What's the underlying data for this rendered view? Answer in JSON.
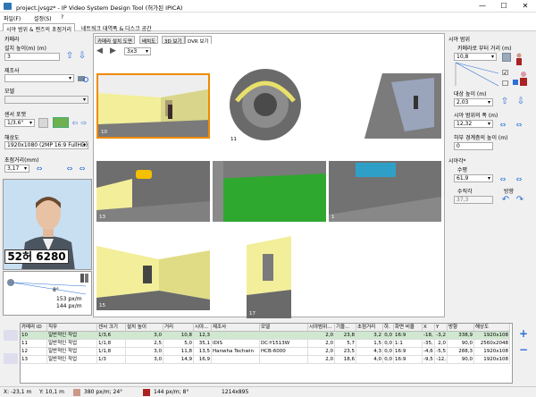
{
  "window": {
    "title": "project.jvsgz* - IP Video System Design Tool (허가된 IPICA)",
    "min": "—",
    "max": "☐",
    "close": "✕"
  },
  "menu": [
    "파일(F)",
    "설정(S)",
    "?"
  ],
  "tabs": [
    "시야 범위 & 렌즈의 초점거리",
    "네트워크 대역폭 & 디스크 공간"
  ],
  "left": {
    "camera_group": "카메라",
    "install_height_label": "설치 높이(m) (m)",
    "install_height_value": "3",
    "manufacturer_label": "제조사",
    "manufacturer_value": "",
    "model_label": "모델",
    "model_value": "",
    "sensor_label": "센서 포맷",
    "sensor_value": "1/3.6\"",
    "resolution_label": "해상도",
    "resolution_value": "1920x1080 (2MP 16:9 FullHD)",
    "focal_label": "초점거리(mm)",
    "focal_value": "3,17",
    "plate_text": "52허 6280",
    "angle_text": "8°",
    "ppm1": "153 px/m",
    "ppm2": "144 px/m"
  },
  "center": {
    "tabs": [
      "카메라 설치 도면",
      "배치도",
      "3D 보기",
      "DVR 보기"
    ],
    "layout_value": "3x3",
    "cells": [
      {
        "num": "10",
        "kind": "yellow"
      },
      {
        "num": "11",
        "kind": "fisheye"
      },
      {
        "num": "12",
        "kind": "blue"
      },
      {
        "num": "13",
        "kind": "car"
      },
      {
        "num": "",
        "kind": "green"
      },
      {
        "num": "1",
        "kind": "bus"
      },
      {
        "num": "15",
        "kind": "yellow2"
      },
      {
        "num": "17",
        "kind": "tall"
      }
    ]
  },
  "right": {
    "view_group": "시야 범위",
    "distance_label": "카메라로 부터 거리 (m)",
    "distance_value": "10,8",
    "target_height_label": "대상 높이 (m)",
    "target_height_value": "2,03",
    "view_width_label": "시야 범위의 폭 (m)",
    "view_width_value": "12,32",
    "lower_label": "하부 경계층의 높이 (m)",
    "lower_value": "0",
    "angle_group": "시야각*",
    "horizontal_label": "수평",
    "horizontal_value": "61,9",
    "vertical_label": "수직각",
    "vertical_value": "37,3",
    "direction_label": "방향"
  },
  "grid": {
    "headers": [
      "카메라 ID",
      "직무",
      "센서 크기",
      "설치 높이",
      "거리",
      "시야...",
      "제조사",
      "모델",
      "시야범위...",
      "기울...",
      "초점거리",
      "하.",
      "화면 비율",
      "X",
      "Y",
      "방향",
      "해상도"
    ],
    "rows": [
      [
        "10",
        "일반적인 작업",
        "1/3,6",
        "3,0",
        "10,8",
        "12,3",
        "",
        "",
        "2,0",
        "23,8",
        "3,2",
        "0,0",
        "16:9",
        "-18,",
        "-3,2",
        "338,9",
        "1920x108"
      ],
      [
        "11",
        "일반적인 작업",
        "1/1,8",
        "2,5",
        "5,0",
        "35,1",
        "IDIS",
        "DC-Y1513W",
        "2,0",
        "5,7",
        "1,5",
        "0,0",
        "1:1",
        "-35,",
        "2,0",
        "90,0",
        "2560x2048"
      ],
      [
        "12",
        "일반적인 작업",
        "1/1,8",
        "3,0",
        "11,8",
        "13,5",
        "Hanwha Techwin",
        "HCB-6000",
        "2,0",
        "23,5",
        "4,3",
        "0,0",
        "16:9",
        "-4,6",
        "-5,5",
        "288,3",
        "1920x108"
      ],
      [
        "13",
        "일반적인 작업",
        "1/3",
        "3,0",
        "14,9",
        "16,9",
        "",
        "",
        "2,0",
        "18,6",
        "4,0",
        "0,0",
        "16:9",
        "-9,5",
        "-12,",
        "90,0",
        "1920x108"
      ]
    ]
  },
  "status": {
    "x": "X: -23,1 m",
    "y": "Y: 10,1 m",
    "ppm_a": "380 px/m; 24°",
    "ppm_b": "144 px/m; 8°",
    "size": "1214x895"
  },
  "colors": {
    "accent": "#2b6fd6",
    "selected_row": "#cfe8cf",
    "highlight_border": "#f08a00",
    "grass": "#2fa82f",
    "wall": "#f2ee9a"
  }
}
